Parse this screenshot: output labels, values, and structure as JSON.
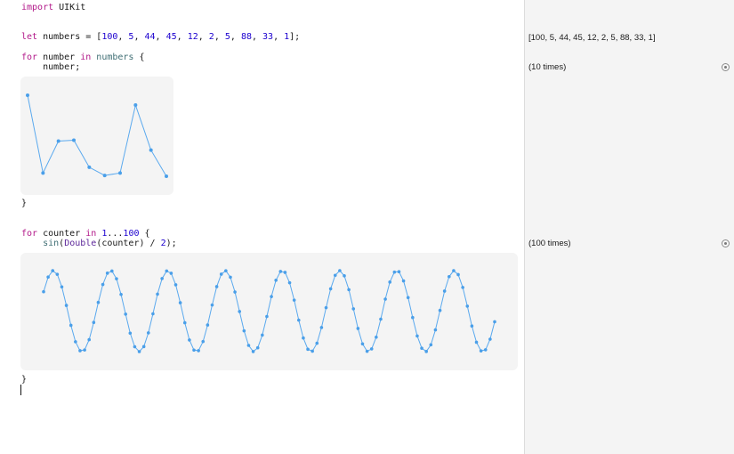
{
  "code": {
    "line1": {
      "kw": "import",
      "rest": " UIKit"
    },
    "line2": {
      "kw": "let",
      "name": " numbers = [",
      "items": [
        "100",
        "5",
        "44",
        "45",
        "12",
        "2",
        "5",
        "88",
        "33",
        "1"
      ],
      "close": "];"
    },
    "line3": {
      "kw": "for",
      "var": " number ",
      "in": "in",
      "coll": " numbers",
      "brace": " {"
    },
    "line4": {
      "text": "    number;"
    },
    "line5": {
      "text": "}"
    },
    "line6": {
      "kw": "for",
      "var": " counter ",
      "in": "in",
      "sp": " ",
      "range_start": "1",
      "dots": "...",
      "range_end": "100",
      "brace": " {"
    },
    "line7": {
      "indent": "    ",
      "fn": "sin",
      "p1": "(",
      "ty": "Double",
      "p2": "(counter) / ",
      "num": "2",
      "p3": ");"
    },
    "line8": {
      "text": "}"
    }
  },
  "results": {
    "numbers_array": "[100, 5, 44, 45, 12, 2, 5, 88, 33, 1]",
    "loop1_count": "(10 times)",
    "loop2_count": "(100 times)"
  },
  "colors": {
    "plot_line": "#5aa9ee",
    "plot_point": "#4a9fe9",
    "keyword": "#b21889",
    "number": "#1c00cf",
    "type": "#5c2699"
  },
  "chart_data": [
    {
      "type": "line",
      "values": [
        100,
        5,
        44,
        45,
        12,
        2,
        5,
        88,
        33,
        1
      ],
      "ylim": [
        1,
        100
      ]
    },
    {
      "type": "line",
      "x": [
        1,
        100
      ],
      "expression": "sin(Double(counter) / 2)",
      "ylim": [
        -1,
        1
      ],
      "samples": 100
    }
  ]
}
